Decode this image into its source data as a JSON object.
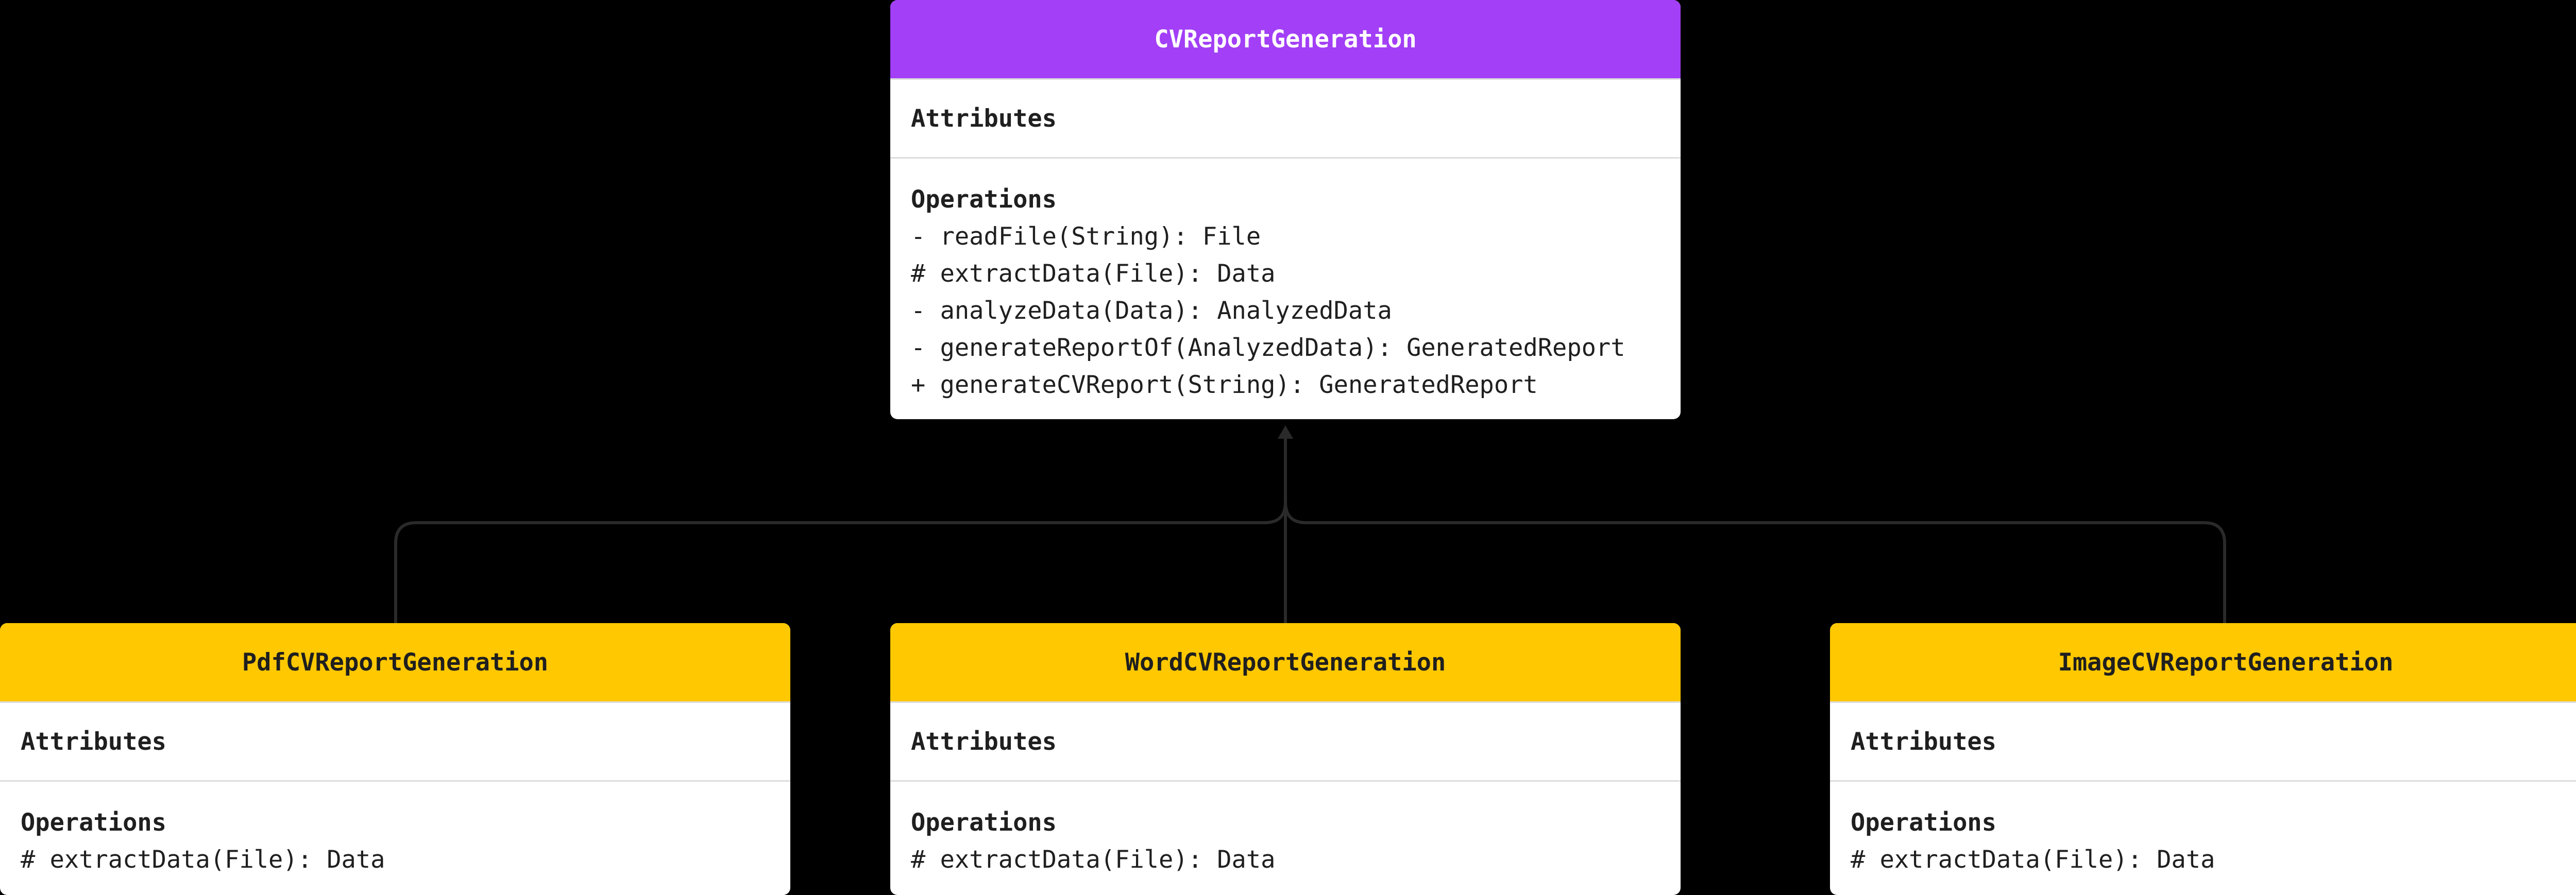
{
  "parent": {
    "name": "CVReportGeneration",
    "attributes_label": "Attributes",
    "operations_label": "Operations",
    "operations": [
      "- readFile(String): File",
      "# extractData(File): Data",
      "- analyzeData(Data): AnalyzedData",
      "- generateReportOf(AnalyzedData): GeneratedReport",
      "+ generateCVReport(String): GeneratedReport"
    ]
  },
  "children": [
    {
      "name": "PdfCVReportGeneration",
      "attributes_label": "Attributes",
      "operations_label": "Operations",
      "operations": [
        "# extractData(File): Data"
      ]
    },
    {
      "name": "WordCVReportGeneration",
      "attributes_label": "Attributes",
      "operations_label": "Operations",
      "operations": [
        "# extractData(File): Data"
      ]
    },
    {
      "name": "ImageCVReportGeneration",
      "attributes_label": "Attributes",
      "operations_label": "Operations",
      "operations": [
        "# extractData(File): Data"
      ]
    }
  ],
  "colors": {
    "parent_header": "#a23ff7",
    "child_header": "#ffc800",
    "connector": "#2a2a2a"
  }
}
